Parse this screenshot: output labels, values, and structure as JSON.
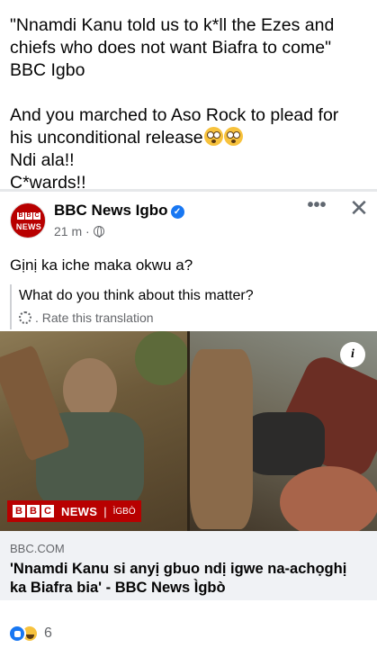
{
  "caption": {
    "lines": [
      "\"Nnamdi Kanu told us to k*ll the Ezes and",
      "chiefs who does not want Biafra to come\"",
      "BBC Igbo",
      "And you marched to Aso Rock to plead for",
      "his unconditional release",
      "Ndi ala!!",
      "C*wards!!"
    ],
    "emojis": [
      "flushed-face",
      "flushed-face"
    ]
  },
  "post": {
    "page_name": "BBC News Igbo",
    "time": "21 m",
    "separator": " · ",
    "avatar_blocks": [
      "B",
      "B",
      "C"
    ],
    "avatar_text": "NEWS",
    "more_label": "•••",
    "close_label": "✕",
    "text": "Gịnị ka iche maka okwu a?",
    "translation": "What do you think about this matter?",
    "rate_label": ". Rate this translation"
  },
  "link": {
    "image_brand_blocks": [
      "B",
      "B",
      "C"
    ],
    "image_brand_word": "NEWS",
    "image_brand_sep": "|",
    "image_brand_lang": "ÌGBÒ",
    "info_label": "i",
    "domain": "BBC.COM",
    "title": "'Nnamdi Kanu si anyị gbuo ndị igwe na-achọghị ka Biafra bia' - BBC News Ìgbò"
  },
  "reactions": {
    "types": [
      "like",
      "haha"
    ],
    "count": "6"
  },
  "colors": {
    "bbc_red": "#b80000",
    "facebook_blue": "#1877f2",
    "muted_text": "#65676b",
    "link_footer_bg": "#f0f2f5"
  }
}
